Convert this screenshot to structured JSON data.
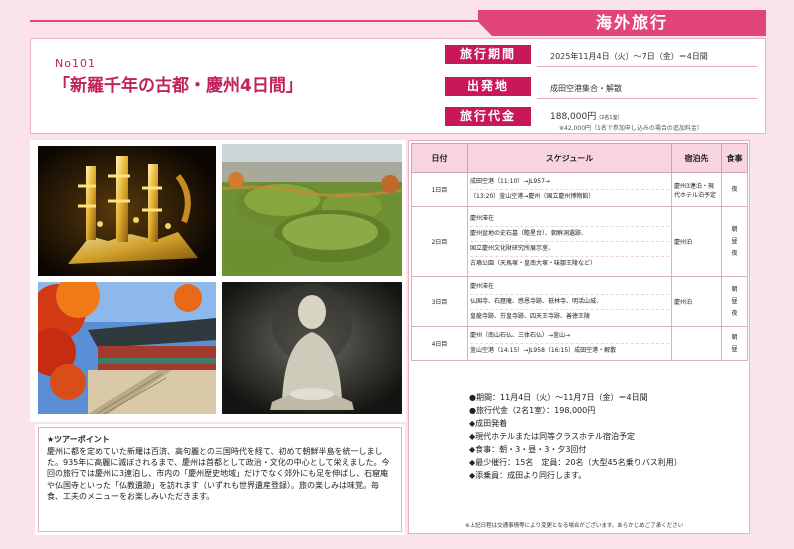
{
  "ribbon": {
    "title": "海外旅行"
  },
  "header": {
    "tour_no": "No101",
    "tour_title": "「新羅千年の古都・慶州4日間」",
    "period_label": "旅行期間",
    "period_value": "2025年11月4日（火）～7日（金）＝4日間",
    "departure_label": "出発地",
    "departure_value": "成田空港集合・解散",
    "price_label": "旅行代金",
    "price_value": "188,000円",
    "price_value_small": "（2名1室）",
    "price_note": "※42,000円（1名で参加申し込みの場合の追加料金）"
  },
  "point": {
    "title": "★ツアーポイント",
    "body": "慶州に都を定めていた新羅は百済、高句麗との三国時代を経て、初めて朝鮮半島を統一しました。935年に高麗に滅ぼされるまで、慶州は首都として政治・文化の中心として栄えました。今回の旅行では慶州に3連泊し、市内の「慶州歴史地域」だけでなく郊外にも足を伸ばし、石窟庵や仏国寺といった「仏教遺跡」を訪れます（いずれも世界遺産登録）。旅の楽しみは味覚。毎食、工夫のメニューをお楽しみいただきます。"
  },
  "schedule": {
    "headers": {
      "day": "日付",
      "schedule": "スケジュール",
      "accommodation": "宿泊先",
      "meals": "食事"
    },
    "days": [
      {
        "day": "1日目",
        "lines": [
          "成田空港（11:10）→JL957→",
          "（13:20）釜山空港→慶州（国立慶州博物館）"
        ],
        "accommodation": "慶州3連泊・現代ホテル泊予定",
        "meals": [
          "夜"
        ]
      },
      {
        "day": "2日目",
        "lines": [
          "慶州滞在",
          "慶州盆地の史石墓（瞻星台）、朝鮮洞遺跡、",
          "国立慶州文化財研究所展示室、",
          "古墳公園（天馬塚・皇南大塚・味鄒王陵など）"
        ],
        "accommodation": "慶州泊",
        "meals": [
          "朝",
          "昼",
          "夜"
        ]
      },
      {
        "day": "3日目",
        "lines": [
          "慶州滞在",
          "仏国寺、石窟庵、感恩寺跡、祇林寺、明活山城、",
          "皇龍寺跡、芬皇寺跡、四天王寺跡、善徳王陵"
        ],
        "accommodation": "慶州泊",
        "meals": [
          "朝",
          "昼",
          "夜"
        ]
      },
      {
        "day": "4日目",
        "lines": [
          "慶州（南山石仏、三体石仏）→釜山→",
          "釜山空港（14:15）→JL958（16:15）成田空港・解散"
        ],
        "accommodation": "",
        "meals": [
          "朝",
          "昼"
        ]
      }
    ],
    "summary": [
      "●期間：11月4日（火）～11月7日（金）＝4日間",
      "●旅行代金（2名1室）：198,000円",
      "◆成田発着",
      "◆現代ホテルまたは同等クラスホテル宿泊予定",
      "◆食事：朝・3・昼・3・夕3回付",
      "◆最少催行：15名　定員：20名（大型45名乗りバス利用）",
      "◆添乗員：成田より同行します。"
    ],
    "footnote": "※上記日程は交通事情等により変更となる場合がございます。あらかじめご了承ください"
  },
  "colors": {
    "accent": "#e2457a",
    "label_bg": "#c8185a",
    "title_text": "#c0235c",
    "page_bg": "#fbe3ea"
  }
}
